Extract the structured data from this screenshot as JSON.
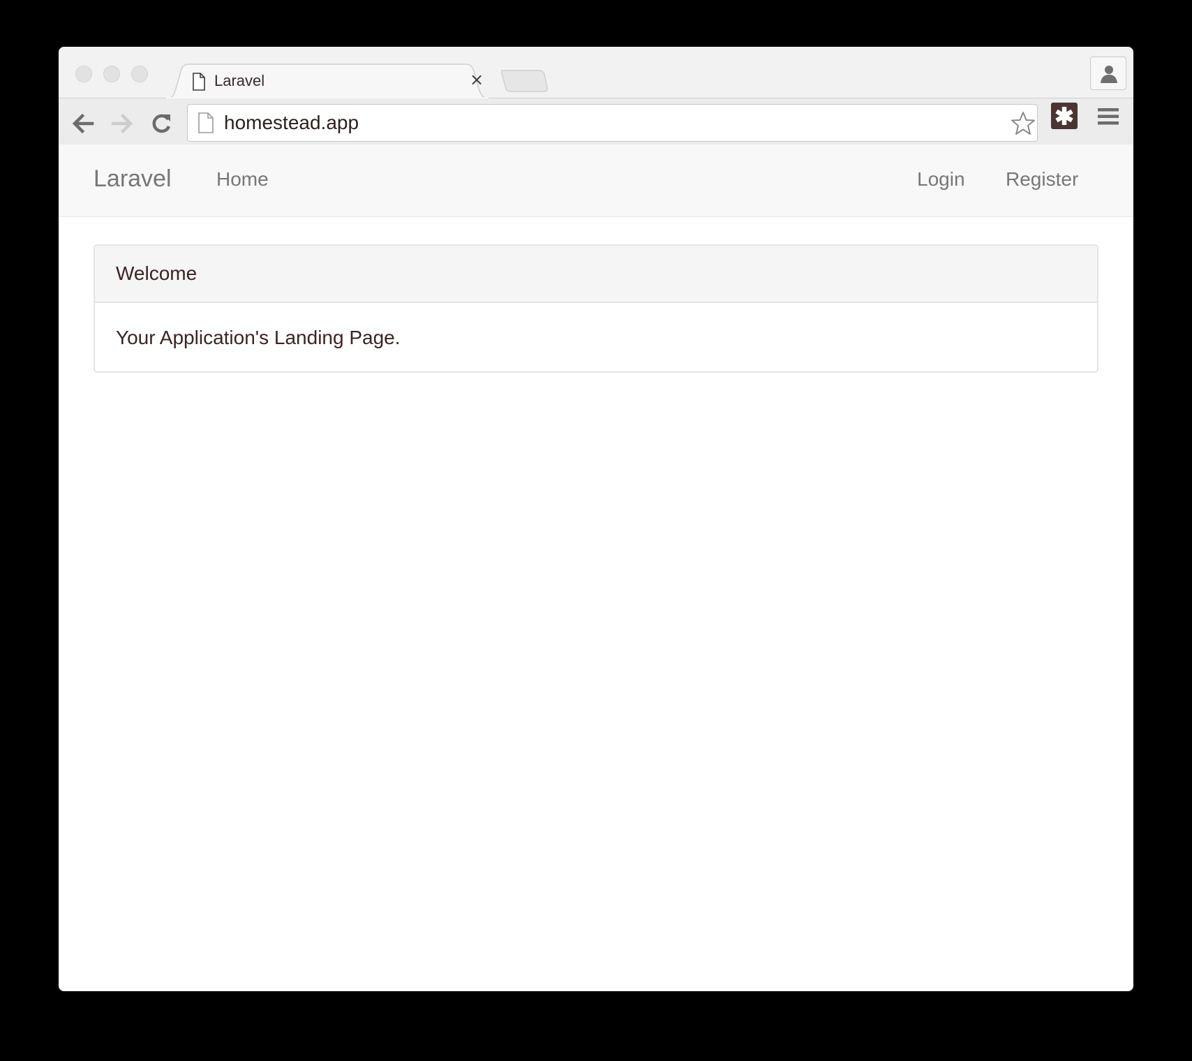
{
  "browser": {
    "tab": {
      "title": "Laravel",
      "close_glyph": "×",
      "icon": "document-icon"
    },
    "address_bar": {
      "url": "homestead.app",
      "icon": "page-icon"
    },
    "toolbar_icons": [
      "back-arrow-icon",
      "forward-arrow-icon",
      "reload-icon",
      "star-icon",
      "extension-icon",
      "menu-icon",
      "profile-icon"
    ]
  },
  "navbar": {
    "brand": "Laravel",
    "links_left": [
      {
        "label": "Home"
      }
    ],
    "links_right": [
      {
        "label": "Login"
      },
      {
        "label": "Register"
      }
    ]
  },
  "panel": {
    "heading": "Welcome",
    "body": "Your Application's Landing Page."
  },
  "colors": {
    "navbar_text": "#777777",
    "panel_text": "#3a2424",
    "navbar_bg": "#f8f8f8",
    "panel_heading_bg": "#f5f5f5"
  }
}
